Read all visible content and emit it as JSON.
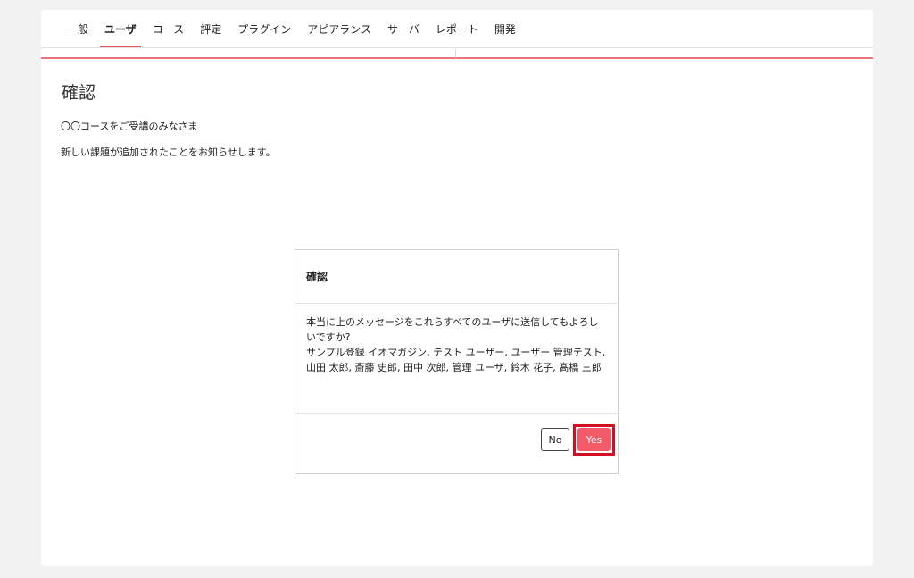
{
  "nav": {
    "tabs": [
      {
        "label": "一般"
      },
      {
        "label": "ユーザ"
      },
      {
        "label": "コース"
      },
      {
        "label": "評定"
      },
      {
        "label": "プラグイン"
      },
      {
        "label": "アピアランス"
      },
      {
        "label": "サーバ"
      },
      {
        "label": "レポート"
      },
      {
        "label": "開発"
      }
    ],
    "active_tab": "ユーザ"
  },
  "page": {
    "title": "確認",
    "message_lines": [
      "〇〇コースをご受講のみなさま",
      "新しい課題が追加されたことをお知らせします。"
    ]
  },
  "dialog": {
    "title": "確認",
    "question": "本当に上のメッセージをこれらすべてのユーザに送信してもよろしいですか?",
    "recipients": "サンプル登録 イオマガジン, テスト ユーザー, ユーザー 管理テスト, 山田 太郎, 斎藤 史郎, 田中 次郎, 管理 ユーザ, 鈴木 花子, 髙橋 三郎",
    "no_label": "No",
    "yes_label": "Yes"
  },
  "colors": {
    "accent": "#e8505b",
    "yes_button": "#f25a68",
    "highlight": "#d01020"
  }
}
